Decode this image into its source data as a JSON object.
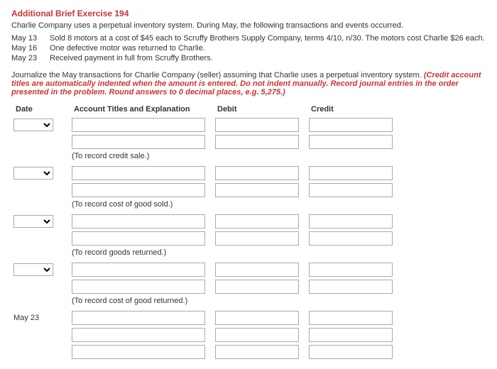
{
  "title": "Additional Brief Exercise 194",
  "intro": "Charlie Company uses a perpetual inventory system. During May, the following transactions and events occurred.",
  "transactions": [
    {
      "date": "May 13",
      "desc": "Sold 8 motors at a cost of $45 each to Scruffy Brothers Supply Company, terms 4/10, n/30. The motors cost Charlie $26 each."
    },
    {
      "date": "May 16",
      "desc": "One defective motor was returned to Charlie."
    },
    {
      "date": "May 23",
      "desc": "Received payment in full from Scruffy Brothers."
    }
  ],
  "instruction_plain": "Journalize the May transactions for Charlie Company (seller) assuming that Charlie uses a perpetual inventory system. ",
  "instruction_red": "(Credit account titles are automatically indented when the amount is entered. Do not indent manually. Record journal entries in the order presented in the problem. Round answers to 0 decimal places, e.g. 5,275.)",
  "headers": {
    "date": "Date",
    "acct": "Account Titles and Explanation",
    "debit": "Debit",
    "credit": "Credit"
  },
  "notes": {
    "n1": "(To record credit sale.)",
    "n2": "(To record cost of good sold.)",
    "n3": "(To record goods returned.)",
    "n4": "(To record cost of good returned.)"
  },
  "static_date": "May 23"
}
